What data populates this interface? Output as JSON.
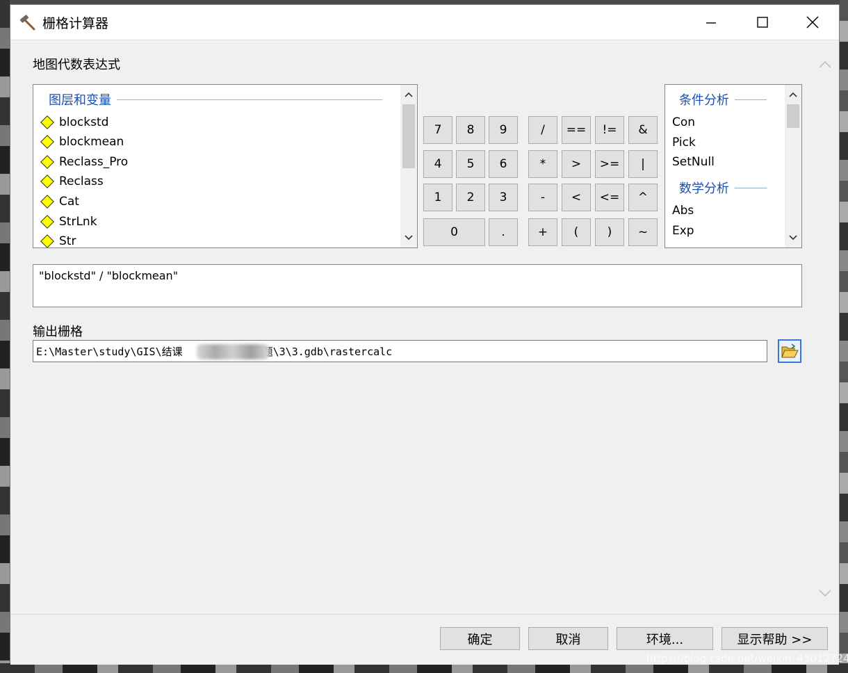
{
  "window": {
    "title": "栅格计算器",
    "minimize_glyph": "—",
    "maximize_glyph": "☐",
    "close_glyph": "✕"
  },
  "expression_section": {
    "label": "地图代数表达式"
  },
  "layers_list": {
    "header": "图层和变量",
    "items": [
      "blockstd",
      "blockmean",
      "Reclass_Pro",
      "Reclass",
      "Cat",
      "StrLnk",
      "Str"
    ]
  },
  "calculator": {
    "row1": [
      "7",
      "8",
      "9",
      "/",
      "==",
      "!=",
      "&"
    ],
    "row2": [
      "4",
      "5",
      "6",
      "*",
      ">",
      ">=",
      "|"
    ],
    "row3": [
      "1",
      "2",
      "3",
      "-",
      "<",
      "<=",
      "^"
    ],
    "row4": [
      "0",
      ".",
      "+",
      "(",
      ")",
      "~"
    ]
  },
  "functions_list": {
    "group1_header": "条件分析",
    "group1_items": [
      "Con",
      "Pick",
      "SetNull"
    ],
    "group2_header": "数学分析",
    "group2_items": [
      "Abs",
      "Exp"
    ]
  },
  "expression": {
    "value": "\"blockstd\" / \"blockmean\""
  },
  "output": {
    "label": "输出栅格",
    "path_start": "E:\\Master\\study\\GIS\\结课",
    "path_end": "课题\\3\\3.gdb\\rastercalc"
  },
  "buttons": {
    "ok": "确定",
    "cancel": "取消",
    "environments": "环境...",
    "show_help": "显示帮助 >>"
  },
  "watermark": "https://blog.csdn.net/weixin_43012724",
  "colors": {
    "accent": "#1a4fb5",
    "layer_icon": "#ffff00"
  }
}
